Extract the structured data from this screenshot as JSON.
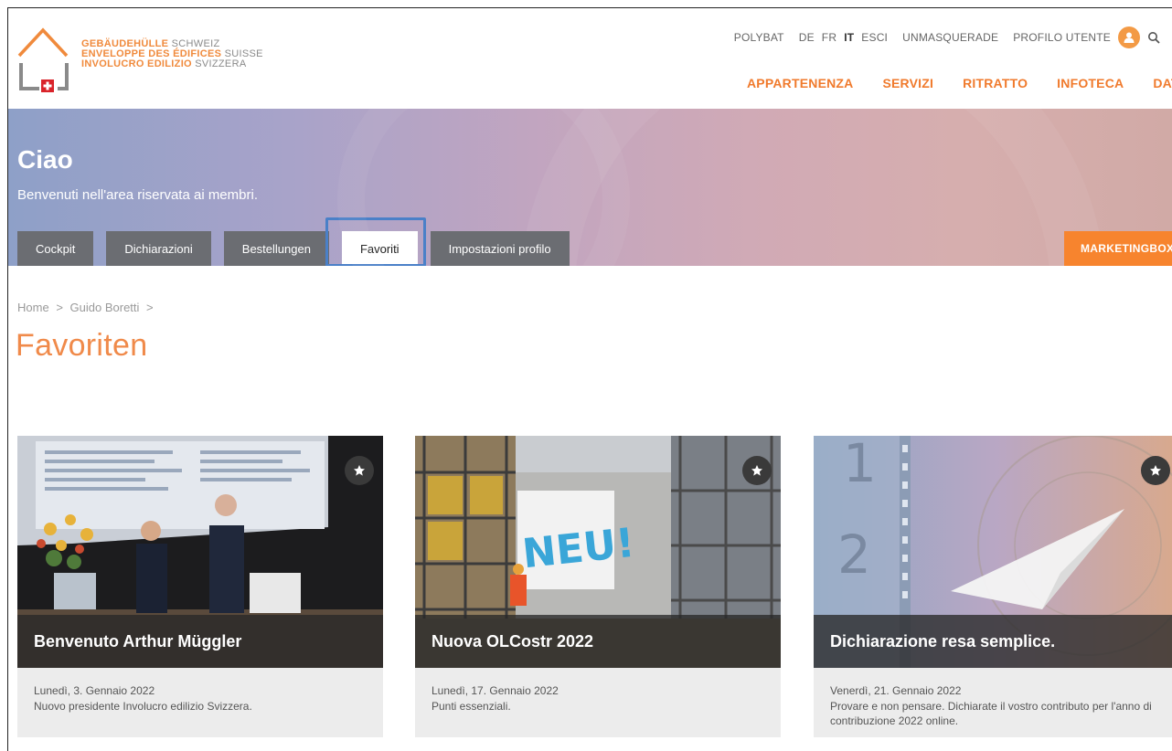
{
  "logo": {
    "line1_accent": "GEBÄUDEHÜLLE",
    "line1_rest": "SCHWEIZ",
    "line2_accent": "ENVELOPPE DES ÉDIFICES",
    "line2_rest": "SUISSE",
    "line3_accent": "INVOLUCRO EDILIZIO",
    "line3_rest": "SVIZZERA"
  },
  "topnav": {
    "polybat": "POLYBAT",
    "lang_de": "DE",
    "lang_fr": "FR",
    "lang_it": "IT",
    "logout": "ESCI",
    "unmasquerade": "UNMASQUERADE",
    "profile": "PROFILO UTENTE"
  },
  "mainnav": [
    "APPARTENENZA",
    "SERVIZI",
    "RITRATTO",
    "INFOTECA",
    "DATI"
  ],
  "banner": {
    "greeting": "Ciao",
    "welcome": "Benvenuti nell'area riservata ai membri."
  },
  "tabs": [
    "Cockpit",
    "Dichiarazioni",
    "Bestellungen",
    "Favoriti",
    "Impostazioni profilo"
  ],
  "marketing_label": "MARKETINGBOX",
  "breadcrumb": {
    "home": "Home",
    "sep": ">",
    "user": "Guido Boretti"
  },
  "page_title": "Favoriten",
  "cards": [
    {
      "title": "Benvenuto Arthur Müggler",
      "date": "Lunedì, 3. Gennaio 2022",
      "desc": "Nuovo presidente Involucro edilizio Svizzera."
    },
    {
      "title": "Nuova OLCostr 2022",
      "date": "Lunedì, 17. Gennaio 2022",
      "desc": "Punti essenziali.",
      "banner_text": "NEU!"
    },
    {
      "title": "Dichiarazione resa semplice.",
      "date": "Venerdì, 21. Gennaio 2022",
      "desc": "Provare e non pensare. Dichiarate il vostro contributo per l'anno di contribuzione 2022 online.",
      "digits": [
        "1",
        "2"
      ]
    }
  ],
  "colors": {
    "accent": "#f07a2c",
    "tab_bg": "#6b6d72",
    "highlight": "#4a80c8",
    "marketing": "#f7842e"
  }
}
